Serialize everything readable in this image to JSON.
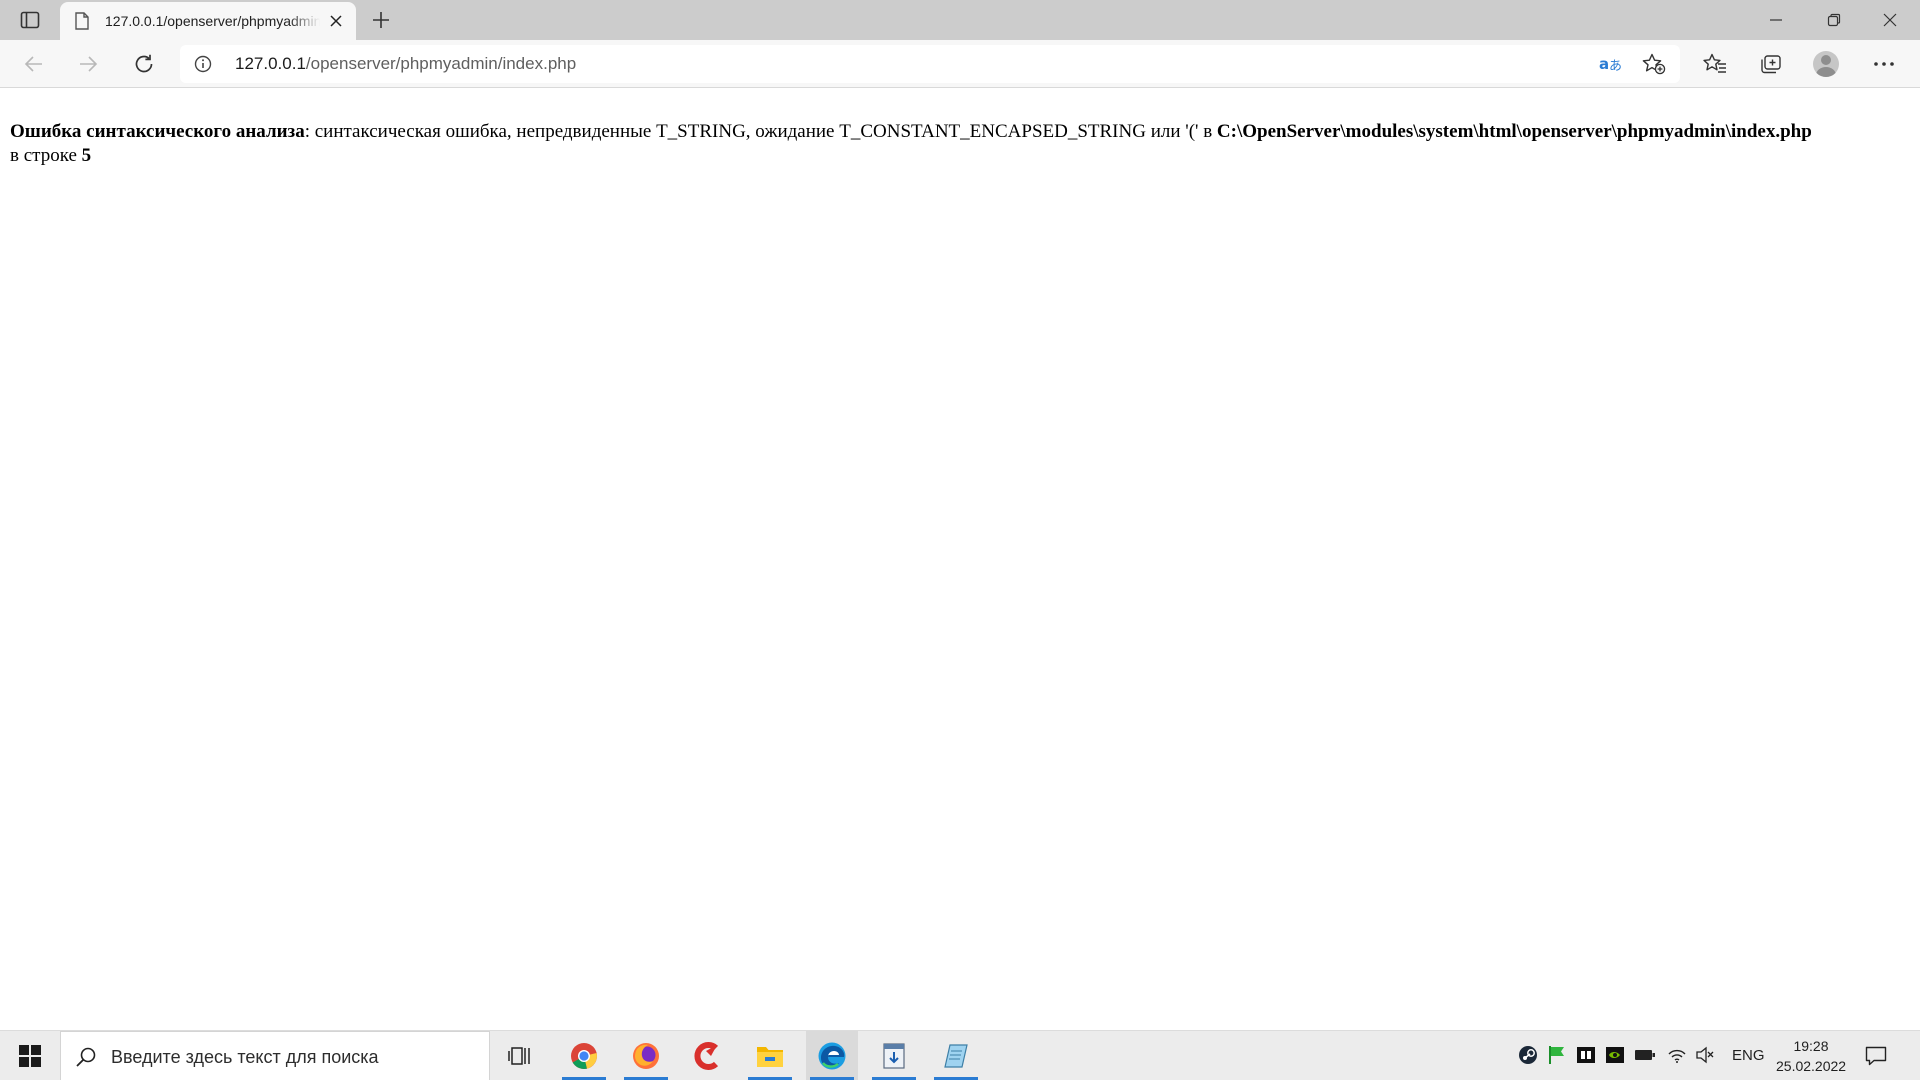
{
  "browser": {
    "tab": {
      "title": "127.0.0.1/openserver/phpmyadmin/index.php"
    },
    "address": {
      "host": "127.0.0.1",
      "path": "/openserver/phpmyadmin/index.php"
    }
  },
  "error": {
    "label": "Ошибка синтаксического анализа",
    "separator": ":",
    "message": " синтаксическая ошибка, непредвиденные T_STRING, ожидание T_CONSTANT_ENCAPSED_STRING или '(' в ",
    "file": "C:\\OpenServer\\modules\\system\\html\\openserver\\phpmyadmin\\index.php",
    "line_prefix": "в строке ",
    "line": "5"
  },
  "taskbar": {
    "search_placeholder": "Введите здесь текст для поиска",
    "apps": [
      {
        "icon": "chrome-icon",
        "running": true
      },
      {
        "icon": "firefox-icon",
        "running": true
      },
      {
        "icon": "ccleaner-icon",
        "running": false
      },
      {
        "icon": "file-explorer-icon",
        "running": true
      },
      {
        "icon": "edge-icon",
        "running": true
      },
      {
        "icon": "installer-icon",
        "running": true
      },
      {
        "icon": "notepad-icon",
        "running": true
      }
    ],
    "tray": {
      "language": "ENG",
      "time": "19:28",
      "date": "25.02.2022"
    }
  },
  "colors": {
    "accent": "#2b7cd3",
    "tabstrip": "#cccccc",
    "toolbar": "#f7f7f7"
  }
}
